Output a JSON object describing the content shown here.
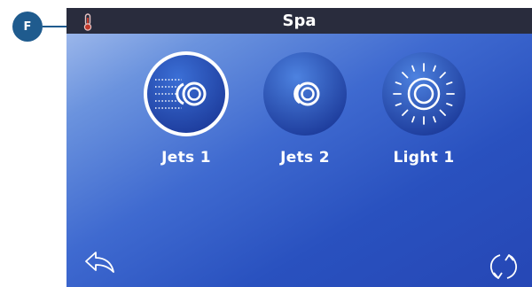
{
  "callout": {
    "letter": "F"
  },
  "header": {
    "title": "Spa",
    "icon": "thermometer-icon"
  },
  "tiles": [
    {
      "label": "Jets 1",
      "icon": "jets-active-icon",
      "active": true
    },
    {
      "label": "Jets 2",
      "icon": "jets-icon",
      "active": false
    },
    {
      "label": "Light 1",
      "icon": "light-icon",
      "active": false
    }
  ],
  "footer": {
    "back_icon": "back-arrow-icon",
    "refresh_icon": "refresh-icon"
  },
  "colors": {
    "accent": "#1f5b8e",
    "header": "#292c3d",
    "panel_dark": "#2647b5",
    "panel_light": "#a9c1ee"
  }
}
